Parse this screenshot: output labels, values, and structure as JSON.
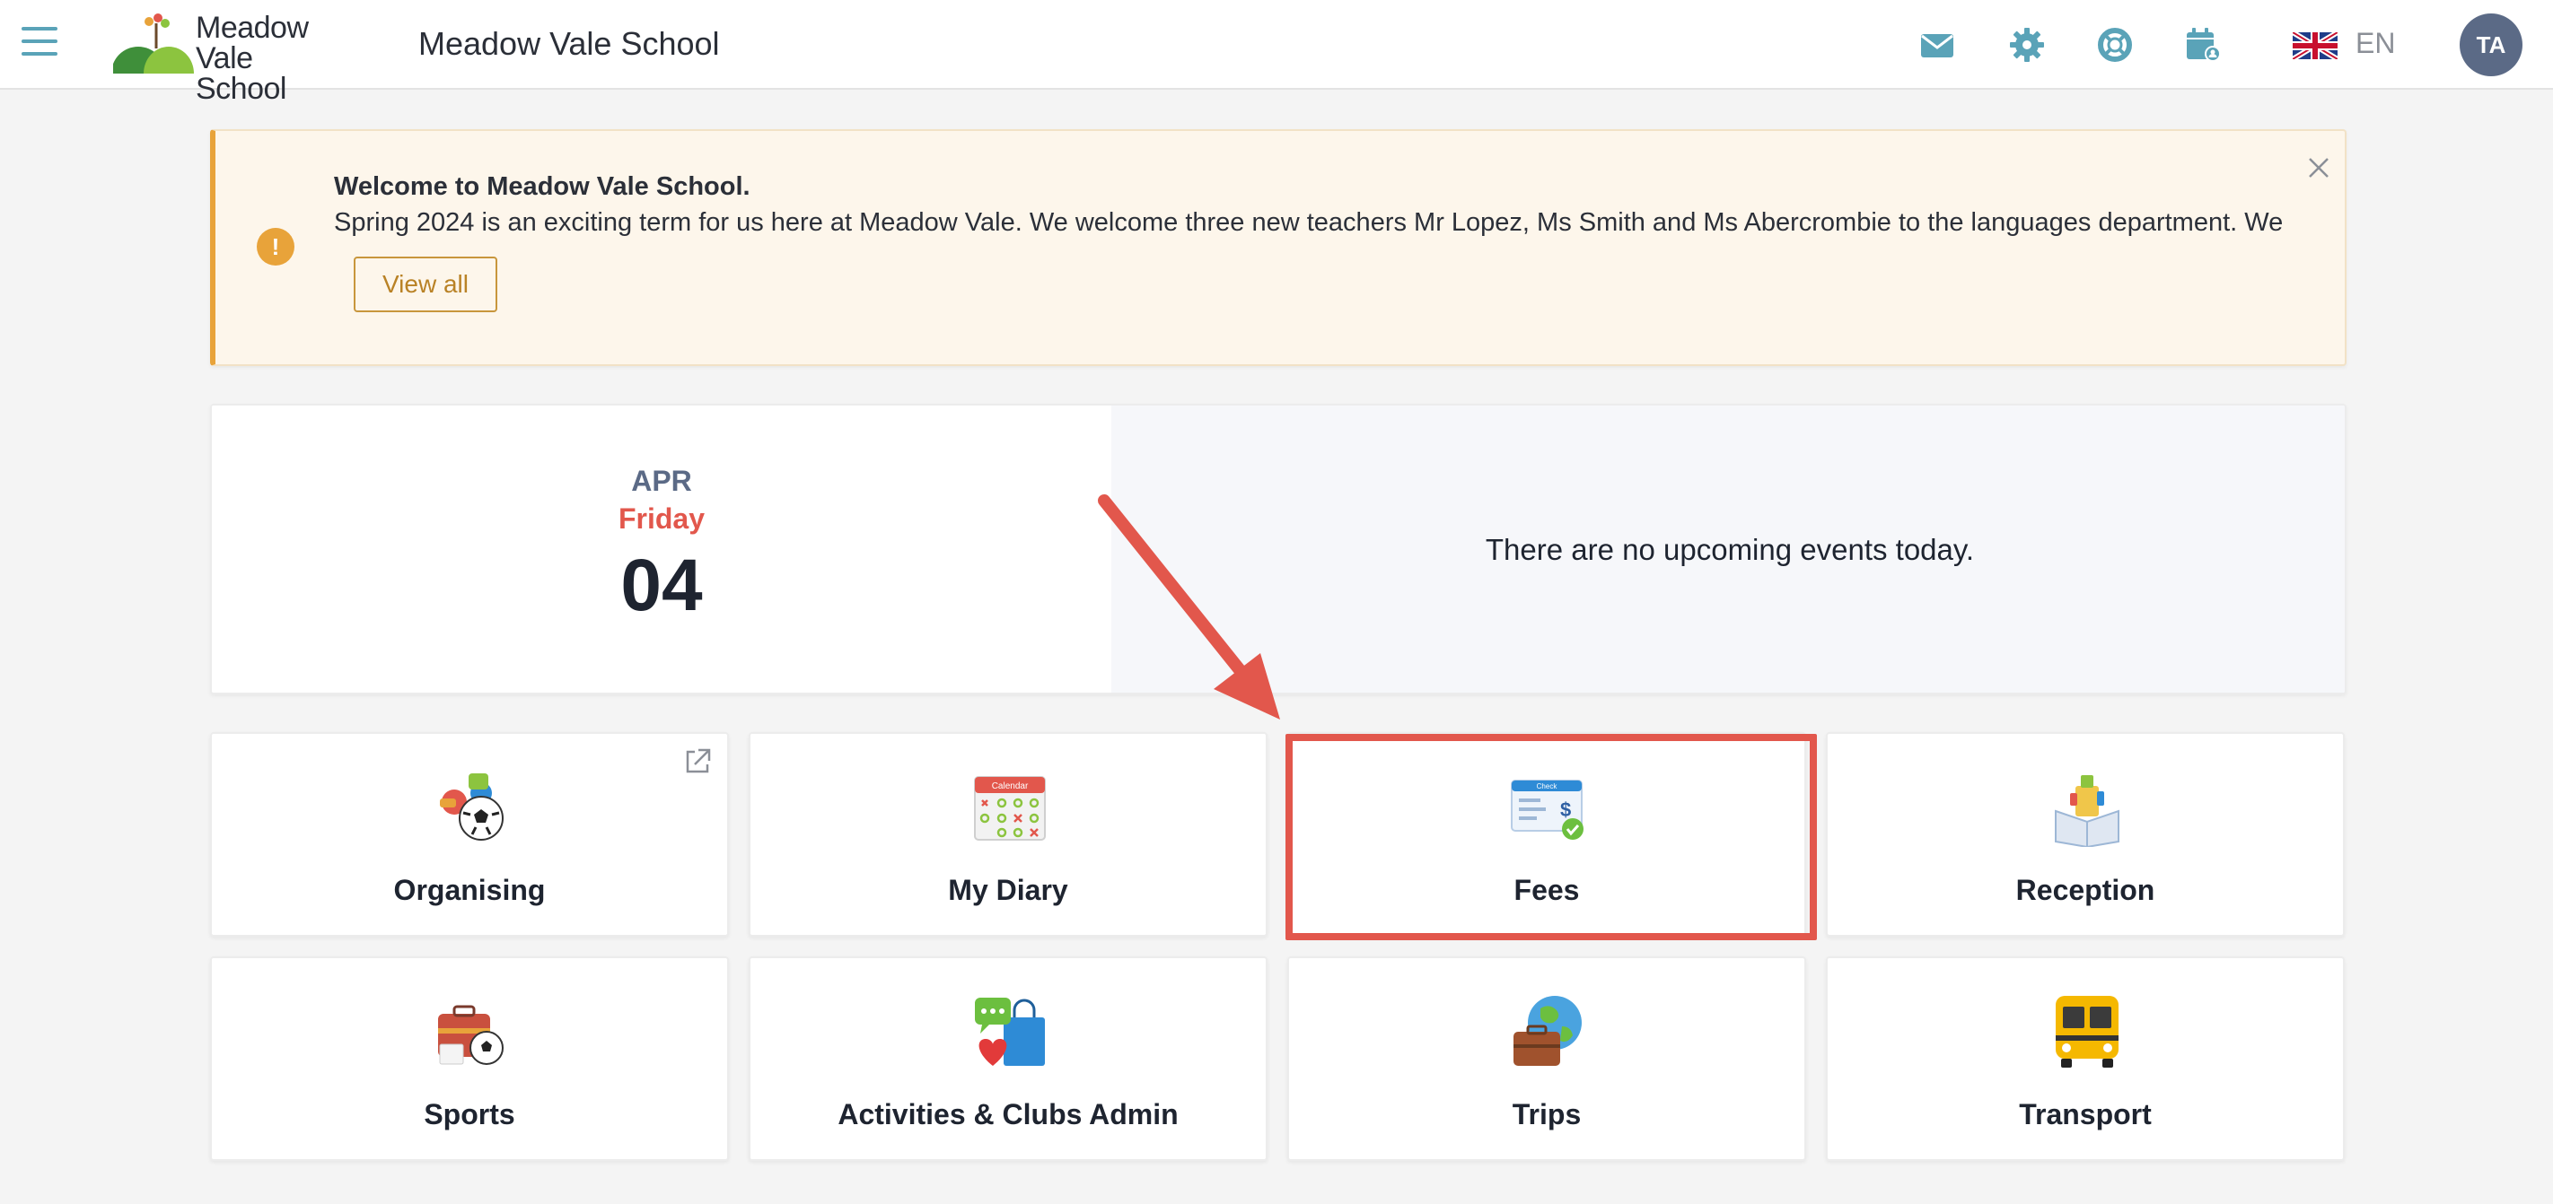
{
  "header": {
    "logo_text_line1": "Meadow",
    "logo_text_line2": "Vale School",
    "app_title": "Meadow Vale School",
    "icons": [
      "envelope-icon",
      "gear-icon",
      "lifebuoy-icon",
      "calendar-user-icon"
    ],
    "language": "EN",
    "avatar_initials": "TA"
  },
  "announcement": {
    "title": "Welcome to Meadow Vale School.",
    "body": "Spring 2024 is an exciting term for us here at Meadow Vale.  We welcome three new teachers Mr Lopez, Ms Smith and Ms Abercrombie to the languages department.  We",
    "view_all_label": "View all",
    "icon": "!"
  },
  "date": {
    "month": "APR",
    "weekday": "Friday",
    "day": "04"
  },
  "events": {
    "empty_text": "There are no upcoming events today."
  },
  "tiles": [
    {
      "label": "Organising",
      "icon": "organising-icon",
      "external": true
    },
    {
      "label": "My Diary",
      "icon": "calendar-icon",
      "icon_text": "Calendar"
    },
    {
      "label": "Fees",
      "icon": "cheque-icon",
      "icon_text": "Check",
      "highlighted": true
    },
    {
      "label": "Reception",
      "icon": "reception-icon"
    },
    {
      "label": "Sports",
      "icon": "sports-icon"
    },
    {
      "label": "Activities & Clubs Admin",
      "icon": "shopping-bag-icon"
    },
    {
      "label": "Trips",
      "icon": "globe-suitcase-icon"
    },
    {
      "label": "Transport",
      "icon": "school-bus-icon"
    }
  ],
  "colors": {
    "accent": "#5aa3b8",
    "warning": "#e8a33a",
    "annotation": "#e2574c",
    "weekday": "#e2574c",
    "month": "#5b6a86"
  }
}
